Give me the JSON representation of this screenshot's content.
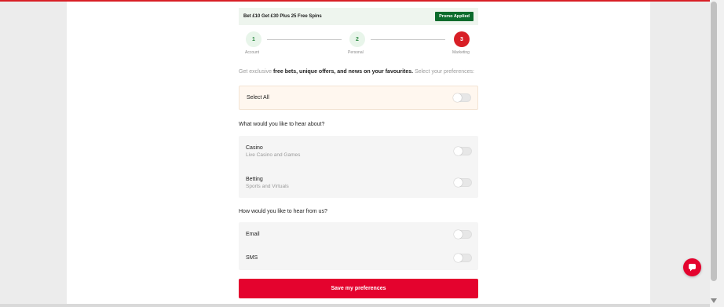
{
  "promo": {
    "text": "Bet £10 Get £30 Plus 25 Free Spins",
    "badge": "Promo Applied"
  },
  "steps": [
    {
      "number": "1",
      "label": "Account",
      "state": "done"
    },
    {
      "number": "2",
      "label": "Personal",
      "state": "done"
    },
    {
      "number": "3",
      "label": "Marketing",
      "state": "active"
    }
  ],
  "intro": {
    "prefix": "Get exclusive ",
    "highlight": "free bets, unique offers, and news on your favourites.",
    "suffix": " Select your preferences:"
  },
  "select_all": {
    "label": "Select All",
    "on": false
  },
  "topics": {
    "heading": "What would you like to hear about?",
    "items": [
      {
        "title": "Casino",
        "subtitle": "Live Casino and Games",
        "on": false
      },
      {
        "title": "Betting",
        "subtitle": "Sports and Virtuals",
        "on": false
      }
    ]
  },
  "channels": {
    "heading": "How would you like to hear from us?",
    "items": [
      {
        "title": "Email",
        "on": false
      },
      {
        "title": "SMS",
        "on": false
      }
    ]
  },
  "save_label": "Save my preferences",
  "colors": {
    "accent": "#e4032e",
    "promo_badge": "#0b6b2c",
    "step_done": "#2e8a43"
  },
  "icons": {
    "chat": "chat-bubble-icon"
  }
}
